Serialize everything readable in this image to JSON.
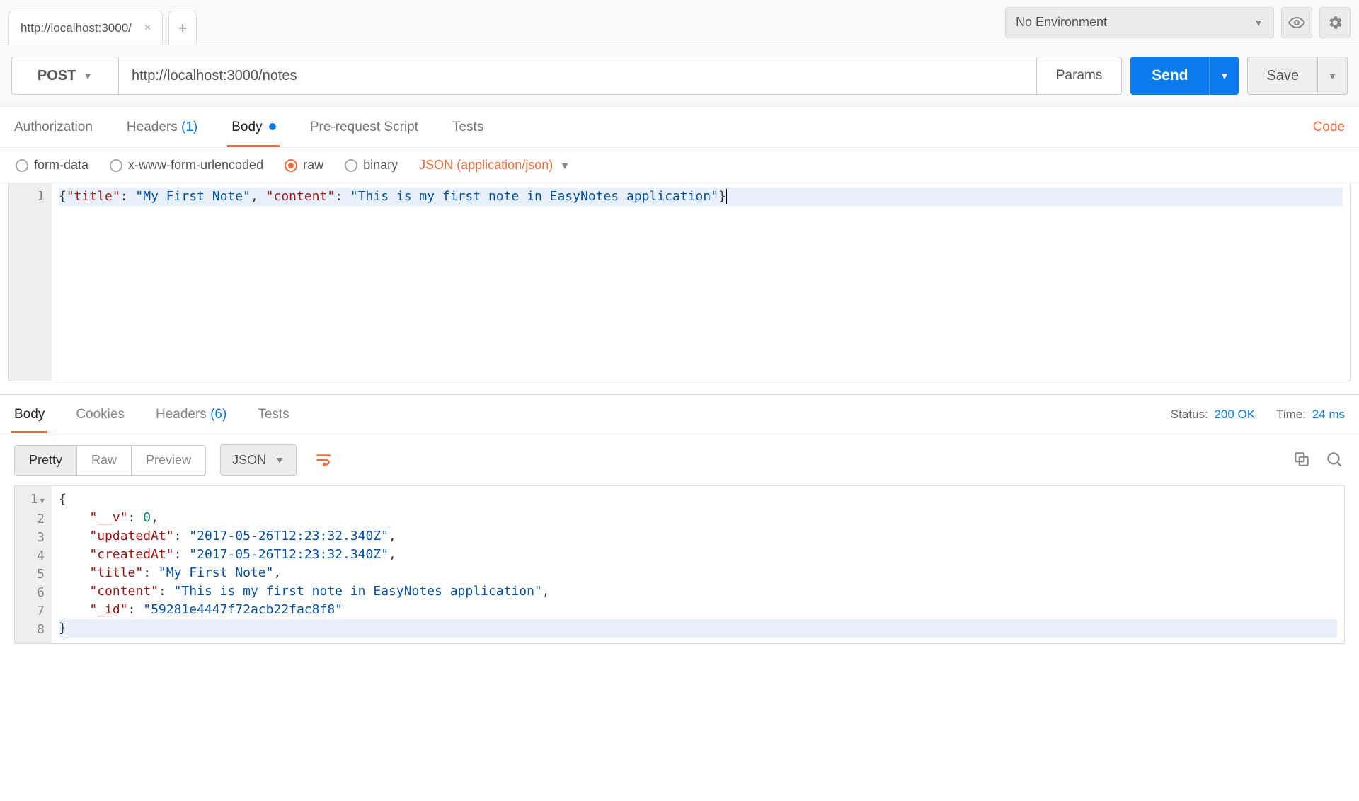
{
  "topbar": {
    "tab_title": "http://localhost:3000/",
    "env_label": "No Environment"
  },
  "request": {
    "method": "POST",
    "url": "http://localhost:3000/notes",
    "params_label": "Params",
    "send_label": "Send",
    "save_label": "Save"
  },
  "req_tabs": {
    "authorization": "Authorization",
    "headers": "Headers",
    "headers_count": "(1)",
    "body": "Body",
    "prerequest": "Pre-request Script",
    "tests": "Tests",
    "code": "Code"
  },
  "body_types": {
    "formdata": "form-data",
    "urlencoded": "x-www-form-urlencoded",
    "raw": "raw",
    "binary": "binary",
    "content_type": "JSON (application/json)"
  },
  "request_body": {
    "line_no": "1",
    "k_title": "\"title\"",
    "v_title": "\"My First Note\"",
    "k_content": "\"content\"",
    "v_content": "\"This is my first note in EasyNotes application\""
  },
  "resp_tabs": {
    "body": "Body",
    "cookies": "Cookies",
    "headers": "Headers",
    "headers_count": "(6)",
    "tests": "Tests"
  },
  "resp_meta": {
    "status_label": "Status:",
    "status_value": "200 OK",
    "time_label": "Time:",
    "time_value": "24 ms"
  },
  "resp_toolbar": {
    "pretty": "Pretty",
    "raw": "Raw",
    "preview": "Preview",
    "format": "JSON"
  },
  "response_body": {
    "lines": [
      "1",
      "2",
      "3",
      "4",
      "5",
      "6",
      "7",
      "8"
    ],
    "k_v": "\"__v\"",
    "v_v": "0",
    "k_updated": "\"updatedAt\"",
    "v_updated": "\"2017-05-26T12:23:32.340Z\"",
    "k_created": "\"createdAt\"",
    "v_created": "\"2017-05-26T12:23:32.340Z\"",
    "k_title": "\"title\"",
    "v_title": "\"My First Note\"",
    "k_content": "\"content\"",
    "v_content": "\"This is my first note in EasyNotes application\"",
    "k_id": "\"_id\"",
    "v_id": "\"59281e4447f72acb22fac8f8\""
  }
}
